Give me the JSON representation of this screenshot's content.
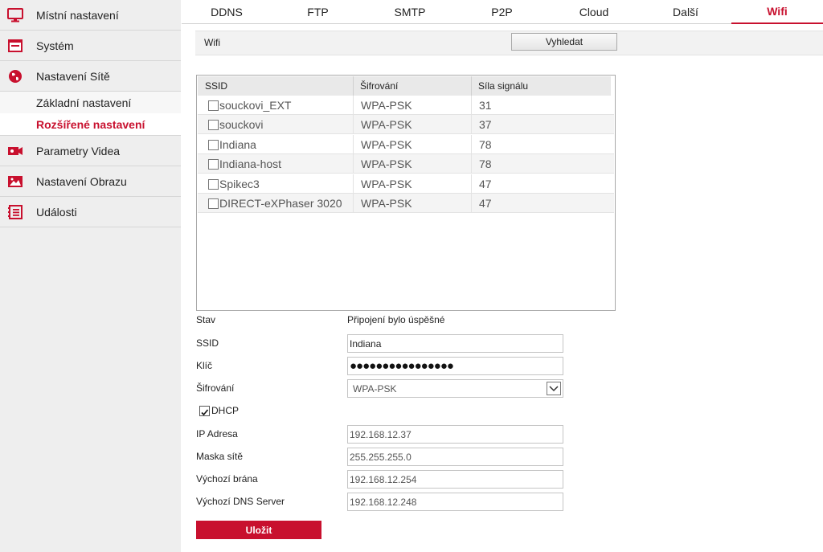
{
  "sidebar": {
    "items": [
      {
        "label": "Místní nastavení",
        "icon": "monitor-icon"
      },
      {
        "label": "Systém",
        "icon": "system-icon"
      },
      {
        "label": "Nastavení Sítě",
        "icon": "globe-icon"
      },
      {
        "label": "Parametry Videa",
        "icon": "video-camera-icon"
      },
      {
        "label": "Nastavení Obrazu",
        "icon": "image-icon"
      },
      {
        "label": "Události",
        "icon": "events-icon"
      }
    ],
    "subitems": [
      {
        "label": "Základní nastavení"
      },
      {
        "label": "Rozšířené nastavení",
        "active": true
      }
    ]
  },
  "tabs": [
    {
      "label": "DDNS"
    },
    {
      "label": "FTP"
    },
    {
      "label": "SMTP"
    },
    {
      "label": "P2P"
    },
    {
      "label": "Cloud"
    },
    {
      "label": "Další"
    },
    {
      "label": "Wifi",
      "active": true
    }
  ],
  "wifi": {
    "title": "Wifi",
    "search_label": "Vyhledat",
    "columns": [
      "SSID",
      "Šifrování",
      "Síla signálu"
    ],
    "networks": [
      {
        "ssid": "souckovi_EXT",
        "encryption": "WPA-PSK",
        "signal": "31"
      },
      {
        "ssid": "souckovi",
        "encryption": "WPA-PSK",
        "signal": "37"
      },
      {
        "ssid": "Indiana",
        "encryption": "WPA-PSK",
        "signal": "78"
      },
      {
        "ssid": "Indiana-host",
        "encryption": "WPA-PSK",
        "signal": "78"
      },
      {
        "ssid": "Spikec3",
        "encryption": "WPA-PSK",
        "signal": "47"
      },
      {
        "ssid": "DIRECT-eXPhaser 3020",
        "encryption": "WPA-PSK",
        "signal": "47"
      }
    ]
  },
  "form": {
    "status_label": "Stav",
    "status_value": "Připojení bylo úspěšné",
    "ssid_label": "SSID",
    "ssid_value": "Indiana",
    "key_label": "Klíč",
    "key_value": "●●●●●●●●●●●●●●●●",
    "encryption_label": "Šifrování",
    "encryption_value": "WPA-PSK",
    "dhcp_label": "DHCP",
    "dhcp_checked": true,
    "ip_label": "IP Adresa",
    "ip_value": "192.168.12.37",
    "mask_label": "Maska sítě",
    "mask_value": "255.255.255.0",
    "gateway_label": "Výchozí brána",
    "gateway_value": "192.168.12.254",
    "dns_label": "Výchozí DNS Server",
    "dns_value": "192.168.12.248",
    "save_label": "Uložit"
  },
  "colors": {
    "accent": "#c8102e",
    "sidebar_bg": "#eeeeee"
  }
}
